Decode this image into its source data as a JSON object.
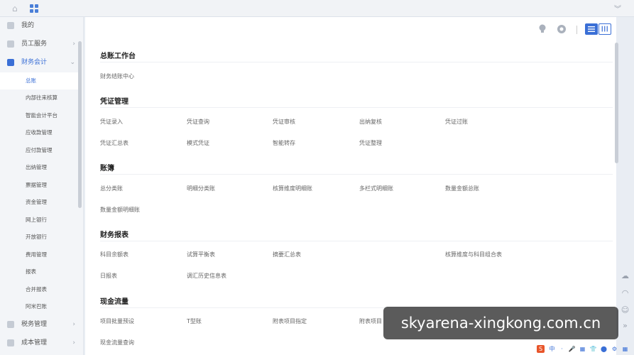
{
  "topbar": {
    "home_icon": "home-icon",
    "apps_icon": "grid-apps-icon",
    "collapse_glyph": "︾"
  },
  "sidebar": {
    "groups": [
      {
        "label": "我的",
        "icon": "user-icon"
      },
      {
        "label": "员工服务",
        "icon": "staff-icon"
      },
      {
        "label": "财务会计",
        "icon": "finance-icon"
      }
    ],
    "subitems": [
      "总账",
      "内部往来核算",
      "智能会计平台",
      "应收款管理",
      "应付款管理",
      "出纳管理",
      "票据管理",
      "资金管理",
      "网上银行",
      "开放银行",
      "费用管理",
      "报表",
      "合并报表",
      "阿米巴账"
    ],
    "bottom_groups": [
      {
        "label": "税务管理",
        "icon": "tax-icon"
      },
      {
        "label": "成本管理",
        "icon": "cost-icon"
      }
    ],
    "chevron": "›",
    "chevron_down": "⌄"
  },
  "main": {
    "sections": [
      {
        "title": "总账工作台",
        "items": [
          [
            "财务结账中心"
          ]
        ]
      },
      {
        "title": "凭证管理",
        "items": [
          [
            "凭证录入",
            "凭证查询",
            "凭证审核",
            "出纳复核",
            "凭证过账"
          ],
          [
            "凭证汇总表",
            "模式凭证",
            "智能转存",
            "凭证整理"
          ]
        ]
      },
      {
        "title": "账簿",
        "items": [
          [
            "总分类账",
            "明细分类账",
            "核算维度明细账",
            "多栏式明细账",
            "数量金额总账"
          ],
          [
            "数量金额明细账"
          ]
        ]
      },
      {
        "title": "财务报表",
        "items": [
          [
            "科目余额表",
            "试算平衡表",
            "摘要汇总表",
            "",
            "核算维度与科目组合表"
          ],
          [
            "日报表",
            "调汇历史信息表"
          ]
        ]
      },
      {
        "title": "现金流量",
        "items": [
          [
            "项目批量预设",
            "T型账",
            "附表项目指定",
            "附表项目"
          ],
          [
            "现金流量查询"
          ]
        ]
      }
    ]
  },
  "overlay": {
    "text": "skyarena-xingkong.com.cn"
  },
  "taskbar": {
    "items": [
      "S",
      "中",
      "·",
      "🎤",
      "▦",
      "👕",
      "⬤",
      "⚙",
      "▦"
    ]
  },
  "colors": {
    "accent": "#3a6fd6"
  }
}
